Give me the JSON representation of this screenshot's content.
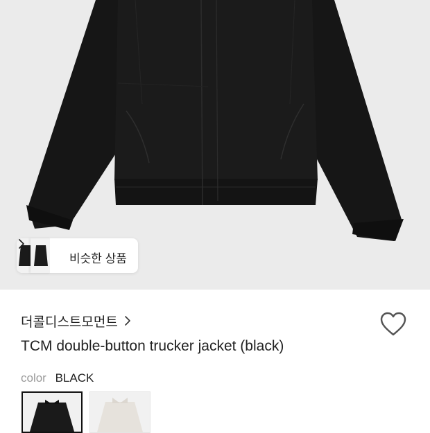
{
  "similar_products": {
    "label": "비슷한 상품"
  },
  "product": {
    "brand": "더콜디스트모먼트",
    "title": "TCM double-button trucker jacket (black)",
    "color_label": "color",
    "color_value": "BLACK"
  },
  "color_options": [
    {
      "name": "black",
      "swatch": "#111111",
      "selected": true
    },
    {
      "name": "ivory",
      "swatch": "#e6e2dc",
      "selected": false
    }
  ],
  "colors": {
    "hero_background": "#ebebeb",
    "jacket": "#1a1a1a"
  },
  "icons": {
    "chevron": "chevron-right-icon",
    "favorite": "heart-outline-icon"
  }
}
